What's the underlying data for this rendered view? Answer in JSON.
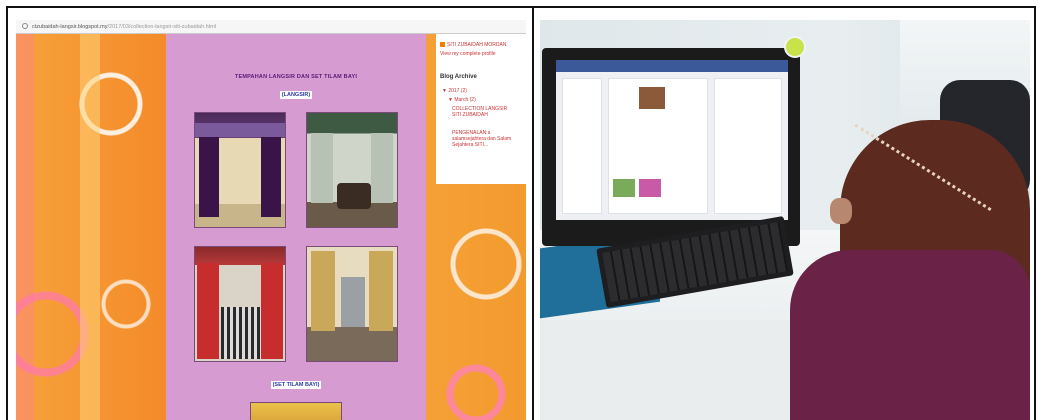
{
  "browser": {
    "url_prefix": "ctzubaidah-langsir.blogspot.my",
    "url_path": "/2017/03/collection-langsir-siti-zubaidah.html"
  },
  "blog": {
    "title": "TEMPAHAN LANGSIR DAN SET TILAM BAYI",
    "section_curtains": "(LANGSIR)",
    "section_baby_set": "(SET TILAM BAYI)"
  },
  "sidebar": {
    "profile_name": "SITI ZUBAIDAH MORDAN",
    "profile_link": "View my complete profile",
    "archive_title": "Blog Archive",
    "year": "▼ 2017 (2)",
    "month": "▼ March (2)",
    "posts": [
      "COLLECTION LANGSIR SITI ZUBAIDAH",
      "PENGENALAN:a salamsejahtera dan Salam Sejahtera SITI..."
    ]
  },
  "colors": {
    "content_bg": "#d69bd0",
    "page_bg": "#f39a2e",
    "link": "#c33333",
    "monitor": "#1b1b1c",
    "hijab": "#6a2346"
  }
}
